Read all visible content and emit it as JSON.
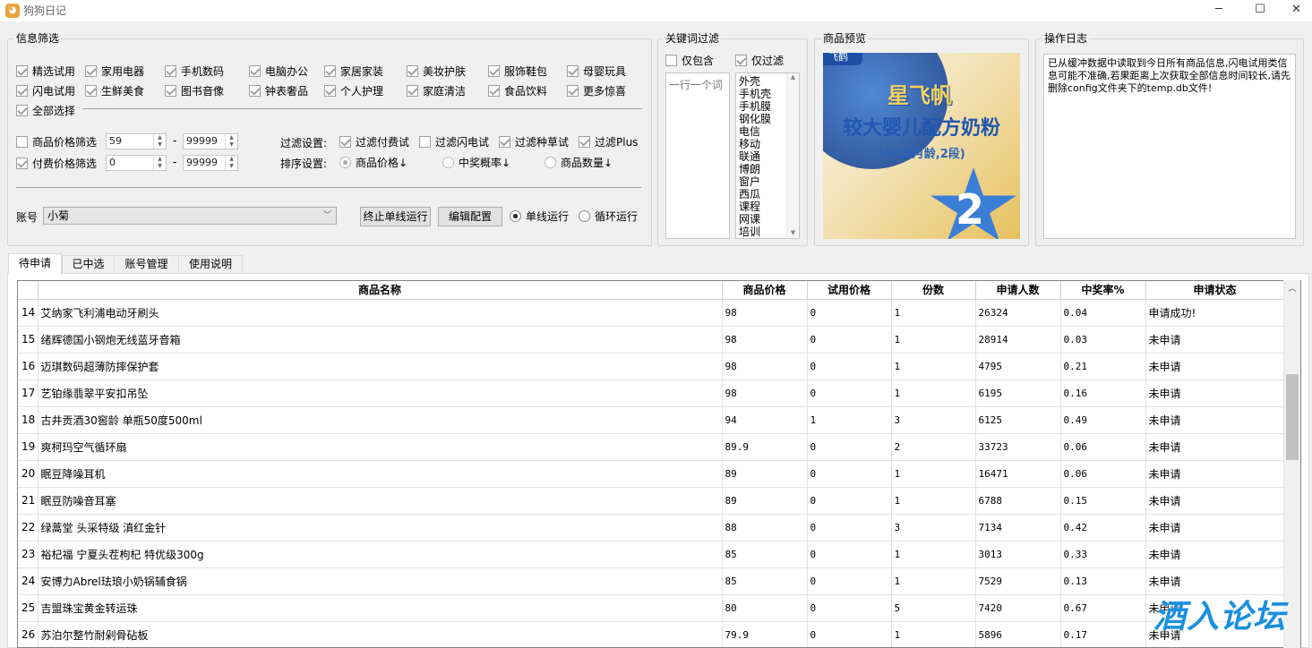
{
  "window": {
    "title": "狗狗日记",
    "minimize": "─",
    "maximize": "☐",
    "close": "✕"
  },
  "filter": {
    "group_title": "信息筛选",
    "categories": [
      {
        "label": "精选试用",
        "checked": true
      },
      {
        "label": "家用电器",
        "checked": true
      },
      {
        "label": "手机数码",
        "checked": true
      },
      {
        "label": "电脑办公",
        "checked": true
      },
      {
        "label": "家居家装",
        "checked": true
      },
      {
        "label": "美妆护肤",
        "checked": true
      },
      {
        "label": "服饰鞋包",
        "checked": true
      },
      {
        "label": "母婴玩具",
        "checked": true
      },
      {
        "label": "闪电试用",
        "checked": true
      },
      {
        "label": "生鲜美食",
        "checked": true
      },
      {
        "label": "图书音像",
        "checked": true
      },
      {
        "label": "钟表奢品",
        "checked": true
      },
      {
        "label": "个人护理",
        "checked": true
      },
      {
        "label": "家庭清洁",
        "checked": true
      },
      {
        "label": "食品饮料",
        "checked": true
      },
      {
        "label": "更多惊喜",
        "checked": true
      }
    ],
    "select_all": "全部选择",
    "price_filter": {
      "label": "商品价格筛选",
      "min": "59",
      "max": "99999",
      "dash": "-"
    },
    "paid_filter": {
      "label": "付费价格筛选",
      "min": "0",
      "max": "99999",
      "dash": "-"
    },
    "filter_settings": {
      "label": "过滤设置:",
      "opts": [
        {
          "label": "过滤付费试",
          "checked": true
        },
        {
          "label": "过滤闪电试",
          "checked": false
        },
        {
          "label": "过滤种草试",
          "checked": true
        },
        {
          "label": "过滤Plus",
          "checked": true
        }
      ]
    },
    "sort_settings": {
      "label": "排序设置:",
      "opts": [
        "商品价格↓",
        "中奖概率↓",
        "商品数量↓"
      ]
    },
    "account": {
      "label": "账号",
      "value": "小菊"
    },
    "stop_button": "终止单线运行",
    "edit_button": "编辑配置",
    "run_single": "单线运行",
    "run_loop": "循环运行"
  },
  "keyword": {
    "group_title": "关键词过滤",
    "only_include": "仅包含",
    "only_filter": "仅过滤",
    "include_placeholder": "一行一个词",
    "filter_words": [
      "外壳",
      "手机壳",
      "手机膜",
      "钢化膜",
      "电信",
      "移动",
      "联通",
      "博朗",
      "窗户",
      "西瓜",
      "课程",
      "网课",
      "培训"
    ]
  },
  "preview": {
    "group_title": "商品预览",
    "brand": "星飞帆",
    "product": "较大婴儿配方奶粉",
    "sub": "(6-12月龄,2段)",
    "corner": "飞鹤",
    "stage": "2"
  },
  "log": {
    "group_title": "操作日志",
    "text": "已从缓冲数据中读取到今日所有商品信息,闪电试用类信息可能不准确,若果距离上次获取全部信息时间较长,请先删除config文件夹下的temp.db文件!"
  },
  "tabs": [
    "待申请",
    "已中选",
    "账号管理",
    "使用说明"
  ],
  "table": {
    "headers": [
      "",
      "商品名称",
      "商品价格",
      "试用价格",
      "份数",
      "申请人数",
      "中奖率%",
      "申请状态"
    ],
    "rows": [
      [
        "14",
        "艾纳家飞利浦电动牙刷头",
        "98",
        "0",
        "1",
        "26324",
        "0.04",
        "申请成功!"
      ],
      [
        "15",
        "绪辉德国小钢炮无线蓝牙音箱",
        "98",
        "0",
        "1",
        "28914",
        "0.03",
        "未申请"
      ],
      [
        "16",
        "迈琪数码超薄防摔保护套",
        "98",
        "0",
        "1",
        "4795",
        "0.21",
        "未申请"
      ],
      [
        "17",
        "艺铂缘翡翠平安扣吊坠",
        "98",
        "0",
        "1",
        "6195",
        "0.16",
        "未申请"
      ],
      [
        "18",
        "古井贡酒30窖龄 单瓶50度500ml",
        "94",
        "1",
        "3",
        "6125",
        "0.49",
        "未申请"
      ],
      [
        "19",
        "爽柯玛空气循环扇",
        "89.9",
        "0",
        "2",
        "33723",
        "0.06",
        "未申请"
      ],
      [
        "20",
        "眠豆降噪耳机",
        "89",
        "0",
        "1",
        "16471",
        "0.06",
        "未申请"
      ],
      [
        "21",
        "眠豆防噪音耳塞",
        "89",
        "0",
        "1",
        "6788",
        "0.15",
        "未申请"
      ],
      [
        "22",
        "绿蒿堂 头采特级 滇红金针",
        "88",
        "0",
        "3",
        "7134",
        "0.42",
        "未申请"
      ],
      [
        "23",
        "裕杞福 宁夏头茬枸杞 特优级300g",
        "85",
        "0",
        "1",
        "3013",
        "0.33",
        "未申请"
      ],
      [
        "24",
        "安博力Abrel珐琅小奶锅辅食锅",
        "85",
        "0",
        "1",
        "7529",
        "0.13",
        "未申请"
      ],
      [
        "25",
        "吉盟珠宝黄金转运珠",
        "80",
        "0",
        "5",
        "7420",
        "0.67",
        "未申请"
      ],
      [
        "26",
        "苏泊尔整竹耐剁骨砧板",
        "79.9",
        "0",
        "1",
        "5896",
        "0.17",
        "未申请"
      ]
    ]
  },
  "watermark": "酒入论坛",
  "colors": {
    "accent": "#1a8fe0",
    "preview_blue": "#2a63b8",
    "preview_gold": "#e8b83a"
  }
}
